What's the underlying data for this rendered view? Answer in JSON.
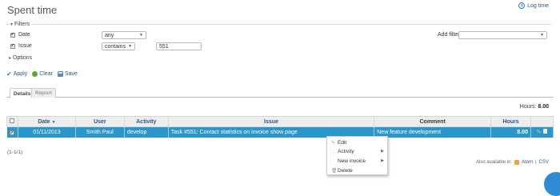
{
  "page": {
    "title": "Spent time",
    "log_time_label": "Log time"
  },
  "filters": {
    "legend": "Filters",
    "date": {
      "label": "Date",
      "checked": true,
      "operator": "any"
    },
    "issue": {
      "label": "Issue",
      "checked": true,
      "operator": "contains",
      "value": "551"
    },
    "add_filter_label": "Add filter",
    "add_filter_value": ""
  },
  "options": {
    "legend": "Options"
  },
  "actions": {
    "apply": "Apply",
    "clear": "Clear",
    "save": "Save"
  },
  "tabs": [
    {
      "label": "Details",
      "active": true
    },
    {
      "label": "Report",
      "active": false
    }
  ],
  "totals": {
    "label": "Hours:",
    "value": "8.00"
  },
  "table": {
    "headers": {
      "date": "Date",
      "user": "User",
      "activity": "Activity",
      "issue": "Issue",
      "comment": "Comment",
      "hours": "Hours"
    },
    "rows": [
      {
        "date": "01/11/2013",
        "user": "Smith Paul",
        "activity": "develop",
        "issue": "Task #551: Contact statistics on invoice show page",
        "comment": "New feature development",
        "hours": "8.00",
        "selected": true
      }
    ]
  },
  "pagination": "(1-1/1)",
  "export": {
    "label": "Also available in:",
    "atom": "Atom",
    "separator": "|",
    "csv": "CSV"
  },
  "context_menu": {
    "items": [
      {
        "label": "Edit",
        "icon": "pencil-icon"
      },
      {
        "label": "Activity",
        "submenu": true
      },
      {
        "label": "New invoice",
        "submenu": true
      },
      {
        "label": "Delete",
        "icon": "trash-icon"
      }
    ]
  },
  "colors": {
    "selected_row": "#2996cc",
    "link": "#2a5685",
    "header_bg": "#eeeeee"
  }
}
